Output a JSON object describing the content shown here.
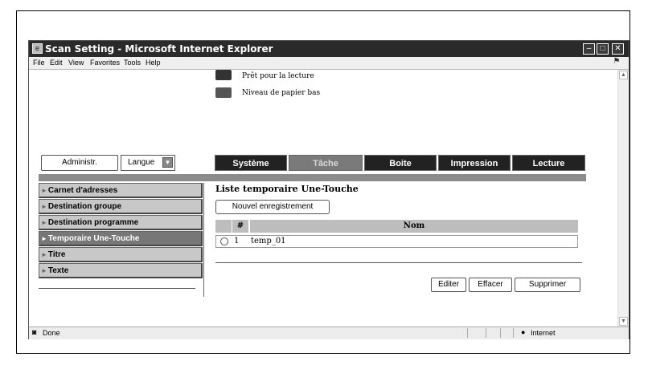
{
  "window": {
    "title": "Scan Setting - Microsoft Internet Explorer",
    "minimize": "–",
    "maximize": "□",
    "close": "✕"
  },
  "menu": [
    "File",
    "Edit",
    "View",
    "Favorites",
    "Tools",
    "Help"
  ],
  "status_panel": {
    "line1": "Prêt pour la lecture",
    "line2": "Niveau de papier bas"
  },
  "controls": {
    "admin_label": "Administr.",
    "language_label": "Langue"
  },
  "tabs": [
    {
      "label": "Système",
      "selected": false
    },
    {
      "label": "Tâche",
      "selected": true
    },
    {
      "label": "Boite",
      "selected": false
    },
    {
      "label": "Impression",
      "selected": false
    },
    {
      "label": "Lecture",
      "selected": false
    }
  ],
  "sidebar": {
    "items": [
      {
        "label": "Carnet d'adresses",
        "active": false
      },
      {
        "label": "Destination groupe",
        "active": false
      },
      {
        "label": "Destination programme",
        "active": false
      },
      {
        "label": "Temporaire Une-Touche",
        "active": true
      },
      {
        "label": "Titre",
        "active": false
      },
      {
        "label": "Texte",
        "active": false
      }
    ]
  },
  "main": {
    "title": "Liste temporaire Une-Touche",
    "new_button": "Nouvel enregistrement",
    "table": {
      "headers": [
        "",
        "#",
        "Nom"
      ],
      "rows": [
        {
          "num": "1",
          "name": "temp_01"
        }
      ]
    },
    "actions": {
      "edit": "Editer",
      "clear": "Effacer",
      "delete": "Supprimer"
    }
  },
  "statusbar": {
    "left": "Done",
    "zone": "Internet"
  },
  "colors": {
    "titlebar": "#2a2a2a",
    "tab": "#222222",
    "tab_selected": "#7a7a7a",
    "sidebar_item": "#c8c8c8",
    "sidebar_active": "#777777"
  }
}
